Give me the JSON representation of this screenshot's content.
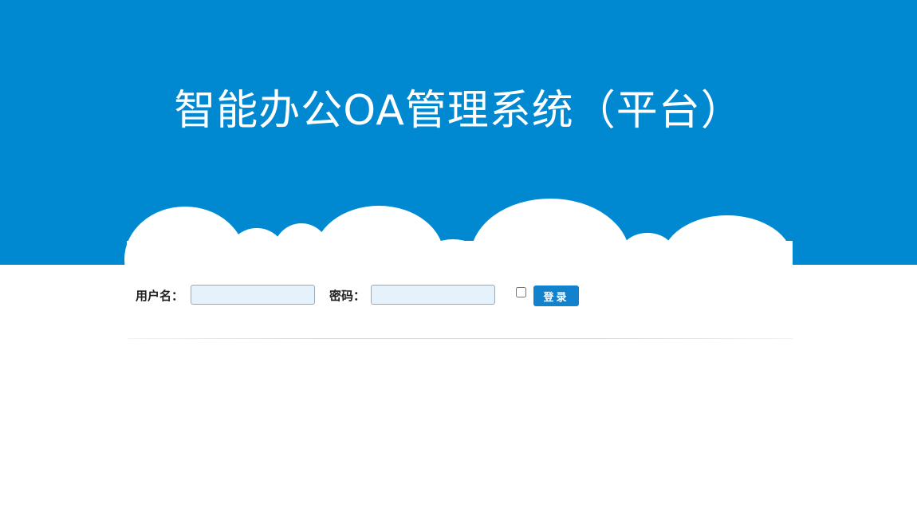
{
  "header": {
    "title": "智能办公OA管理系统（平台）",
    "background_color": "#0088d1",
    "decoration": "cloud-illustration"
  },
  "login_form": {
    "username_label": "用户名：",
    "username_value": "",
    "password_label": "密码：",
    "password_value": "",
    "remember_checked": false,
    "submit_label": "登录",
    "submit_color": "#1382cc",
    "field_background": "#e6f2fb"
  }
}
